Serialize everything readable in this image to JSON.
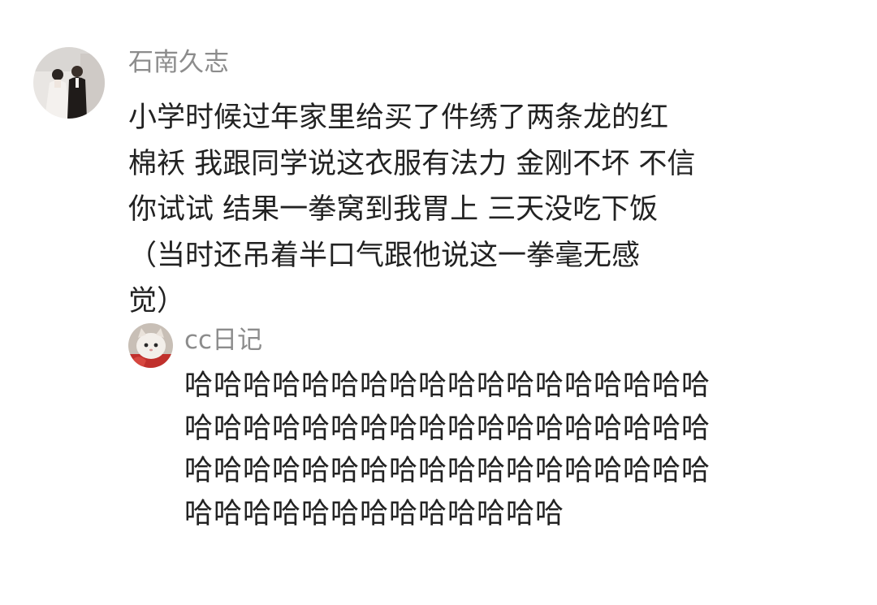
{
  "comment": {
    "username": "石南久志",
    "avatar_icon": "user-avatar-photo",
    "text_lines": [
      "小学时候过年家里给买了件绣了两条龙的红",
      "棉袄 我跟同学说这衣服有法力 金刚不坏 不信",
      "你试试  结果一拳窝到我胃上 三天没吃下饭",
      "（当时还吊着半口气跟他说这一拳毫无感",
      "觉）"
    ]
  },
  "reply": {
    "username": "cc日记",
    "avatar_icon": "cat-avatar",
    "text_lines": [
      "哈哈哈哈哈哈哈哈哈哈哈哈哈哈哈哈哈哈",
      "哈哈哈哈哈哈哈哈哈哈哈哈哈哈哈哈哈哈",
      "哈哈哈哈哈哈哈哈哈哈哈哈哈哈哈哈哈哈",
      "哈哈哈哈哈哈哈哈哈哈哈哈哈"
    ]
  }
}
